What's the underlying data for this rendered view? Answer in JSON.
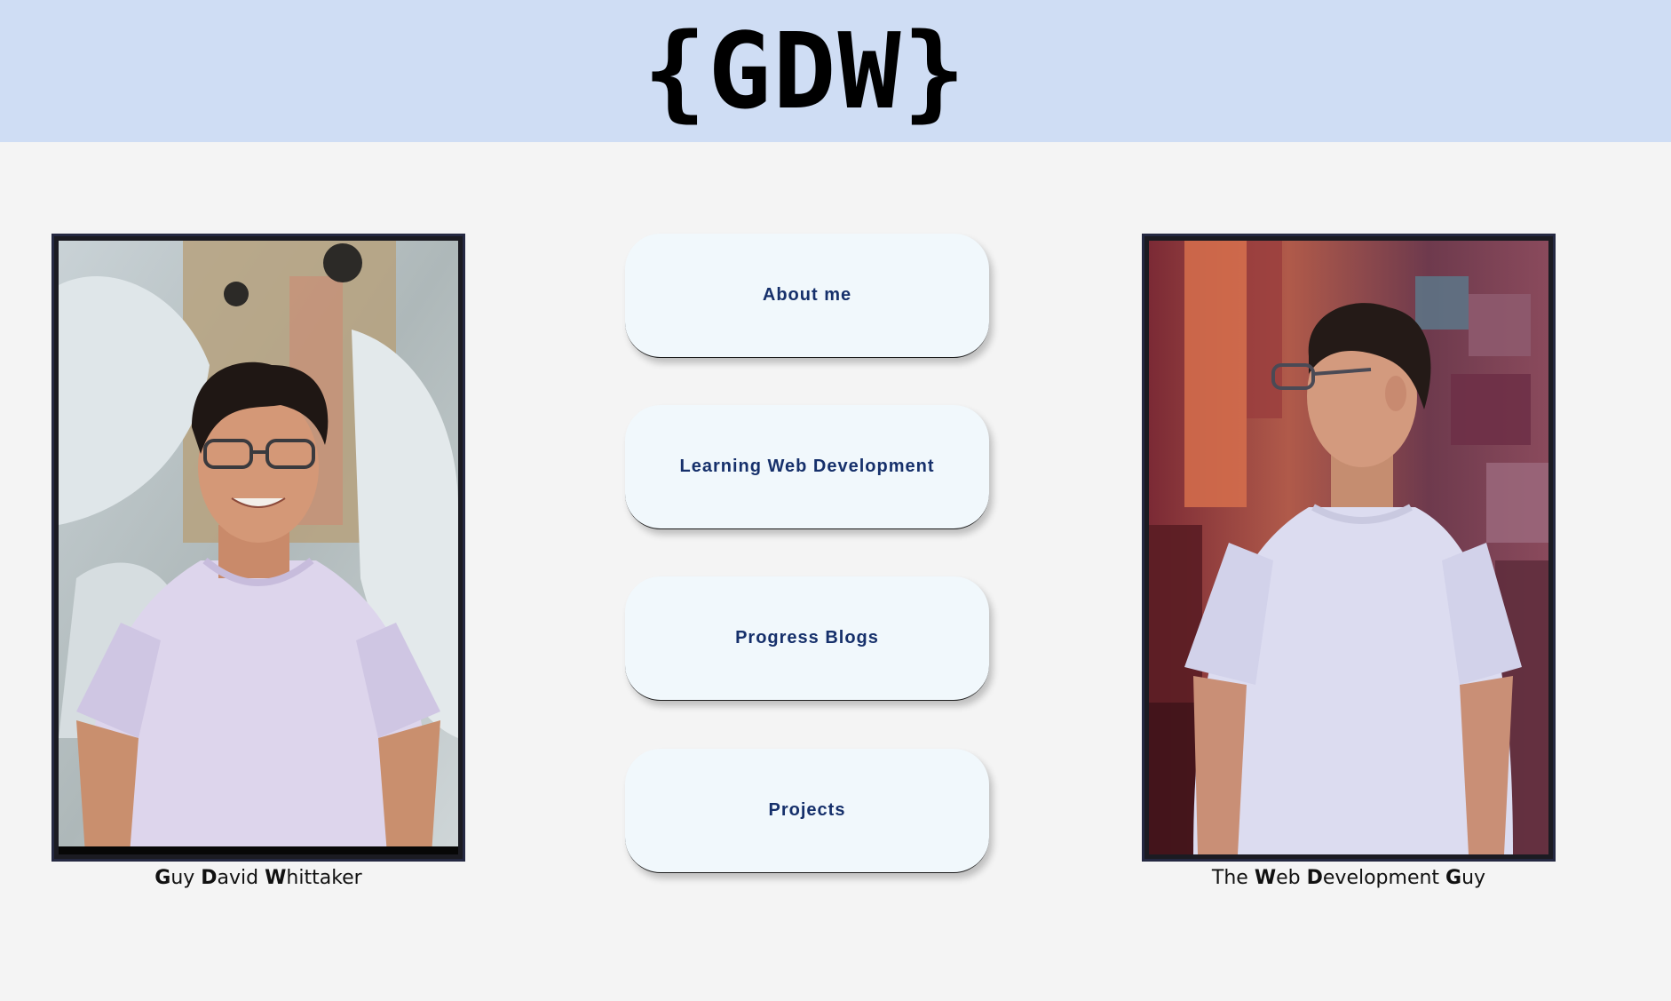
{
  "header": {
    "logo_text": "{GDW}"
  },
  "nav": {
    "about": "About me",
    "learning": "Learning Web Development",
    "blogs": "Progress Blogs",
    "projects": "Projects"
  },
  "left_caption": {
    "p1b": "G",
    "p1": "uy ",
    "p2b": "D",
    "p2": "avid ",
    "p3b": "W",
    "p3": "hittaker"
  },
  "right_caption": {
    "p0": "The ",
    "p1b": "W",
    "p1": "eb ",
    "p2b": "D",
    "p2": "evelopment ",
    "p3b": "G",
    "p3": "uy"
  },
  "colors": {
    "header_bg": "#cfddf4",
    "page_bg": "#f4f4f4",
    "button_bg": "#f1f8fc",
    "button_text": "#16306b",
    "frame_border": "#242841"
  }
}
